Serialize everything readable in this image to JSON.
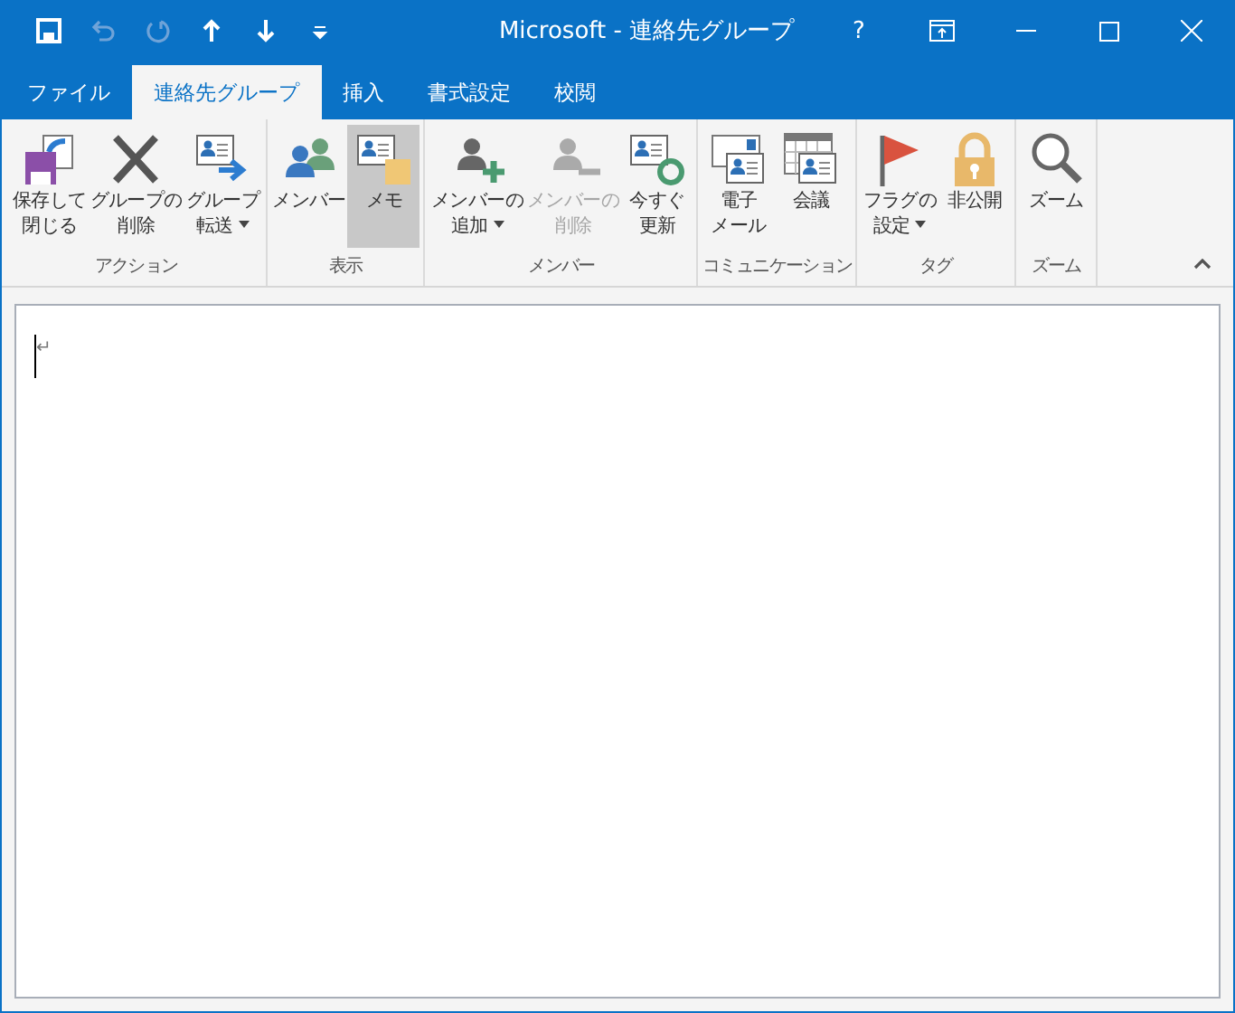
{
  "window": {
    "title": "Microsoft - 連絡先グループ",
    "help": "?"
  },
  "quick_access": [
    {
      "kind": "save",
      "disabled": false
    },
    {
      "kind": "undo",
      "disabled": true
    },
    {
      "kind": "redo",
      "disabled": true
    },
    {
      "kind": "up",
      "disabled": false
    },
    {
      "kind": "down",
      "disabled": false
    },
    {
      "kind": "customize",
      "disabled": false
    }
  ],
  "tabs": [
    {
      "label": "ファイル",
      "selected": false
    },
    {
      "label": "連絡先グループ",
      "selected": true
    },
    {
      "label": "挿入",
      "selected": false
    },
    {
      "label": "書式設定",
      "selected": false
    },
    {
      "label": "校閲",
      "selected": false
    }
  ],
  "ribbon_groups": [
    {
      "label": "アクション",
      "buttons": [
        {
          "kind": "save-close",
          "lines": [
            "保存して",
            "閉じる"
          ],
          "dropdown": false,
          "disabled": false,
          "selected": false
        },
        {
          "kind": "delete",
          "lines": [
            "グループの",
            "削除"
          ],
          "dropdown": false,
          "disabled": false,
          "selected": false
        },
        {
          "kind": "forward",
          "lines": [
            "グループ",
            "転送"
          ],
          "dropdown": true,
          "disabled": false,
          "selected": false
        }
      ]
    },
    {
      "label": "表示",
      "buttons": [
        {
          "kind": "members",
          "lines": [
            "メンバー"
          ],
          "dropdown": false,
          "disabled": false,
          "selected": false
        },
        {
          "kind": "notes",
          "lines": [
            "メモ"
          ],
          "dropdown": false,
          "disabled": false,
          "selected": true
        }
      ]
    },
    {
      "label": "メンバー",
      "buttons": [
        {
          "kind": "add-member",
          "lines": [
            "メンバーの",
            "追加"
          ],
          "dropdown": true,
          "disabled": false,
          "selected": false
        },
        {
          "kind": "remove-member",
          "lines": [
            "メンバーの",
            "削除"
          ],
          "dropdown": false,
          "disabled": true,
          "selected": false
        },
        {
          "kind": "refresh",
          "lines": [
            "今すぐ",
            "更新"
          ],
          "dropdown": false,
          "disabled": false,
          "selected": false
        }
      ]
    },
    {
      "label": "コミュニケーション",
      "buttons": [
        {
          "kind": "email",
          "lines": [
            "電子",
            "メール"
          ],
          "dropdown": false,
          "disabled": false,
          "selected": false
        },
        {
          "kind": "meeting",
          "lines": [
            "会議"
          ],
          "dropdown": false,
          "disabled": false,
          "selected": false
        }
      ]
    },
    {
      "label": "タグ",
      "buttons": [
        {
          "kind": "flag",
          "lines": [
            "フラグの",
            "設定"
          ],
          "dropdown": true,
          "disabled": false,
          "selected": false
        },
        {
          "kind": "lock",
          "lines": [
            "非公開"
          ],
          "dropdown": false,
          "disabled": false,
          "selected": false
        }
      ]
    },
    {
      "label": "ズーム",
      "buttons": [
        {
          "kind": "zoom",
          "lines": [
            "ズーム"
          ],
          "dropdown": false,
          "disabled": false,
          "selected": false
        }
      ]
    }
  ],
  "editor": {
    "paragraph_mark": "↵"
  }
}
